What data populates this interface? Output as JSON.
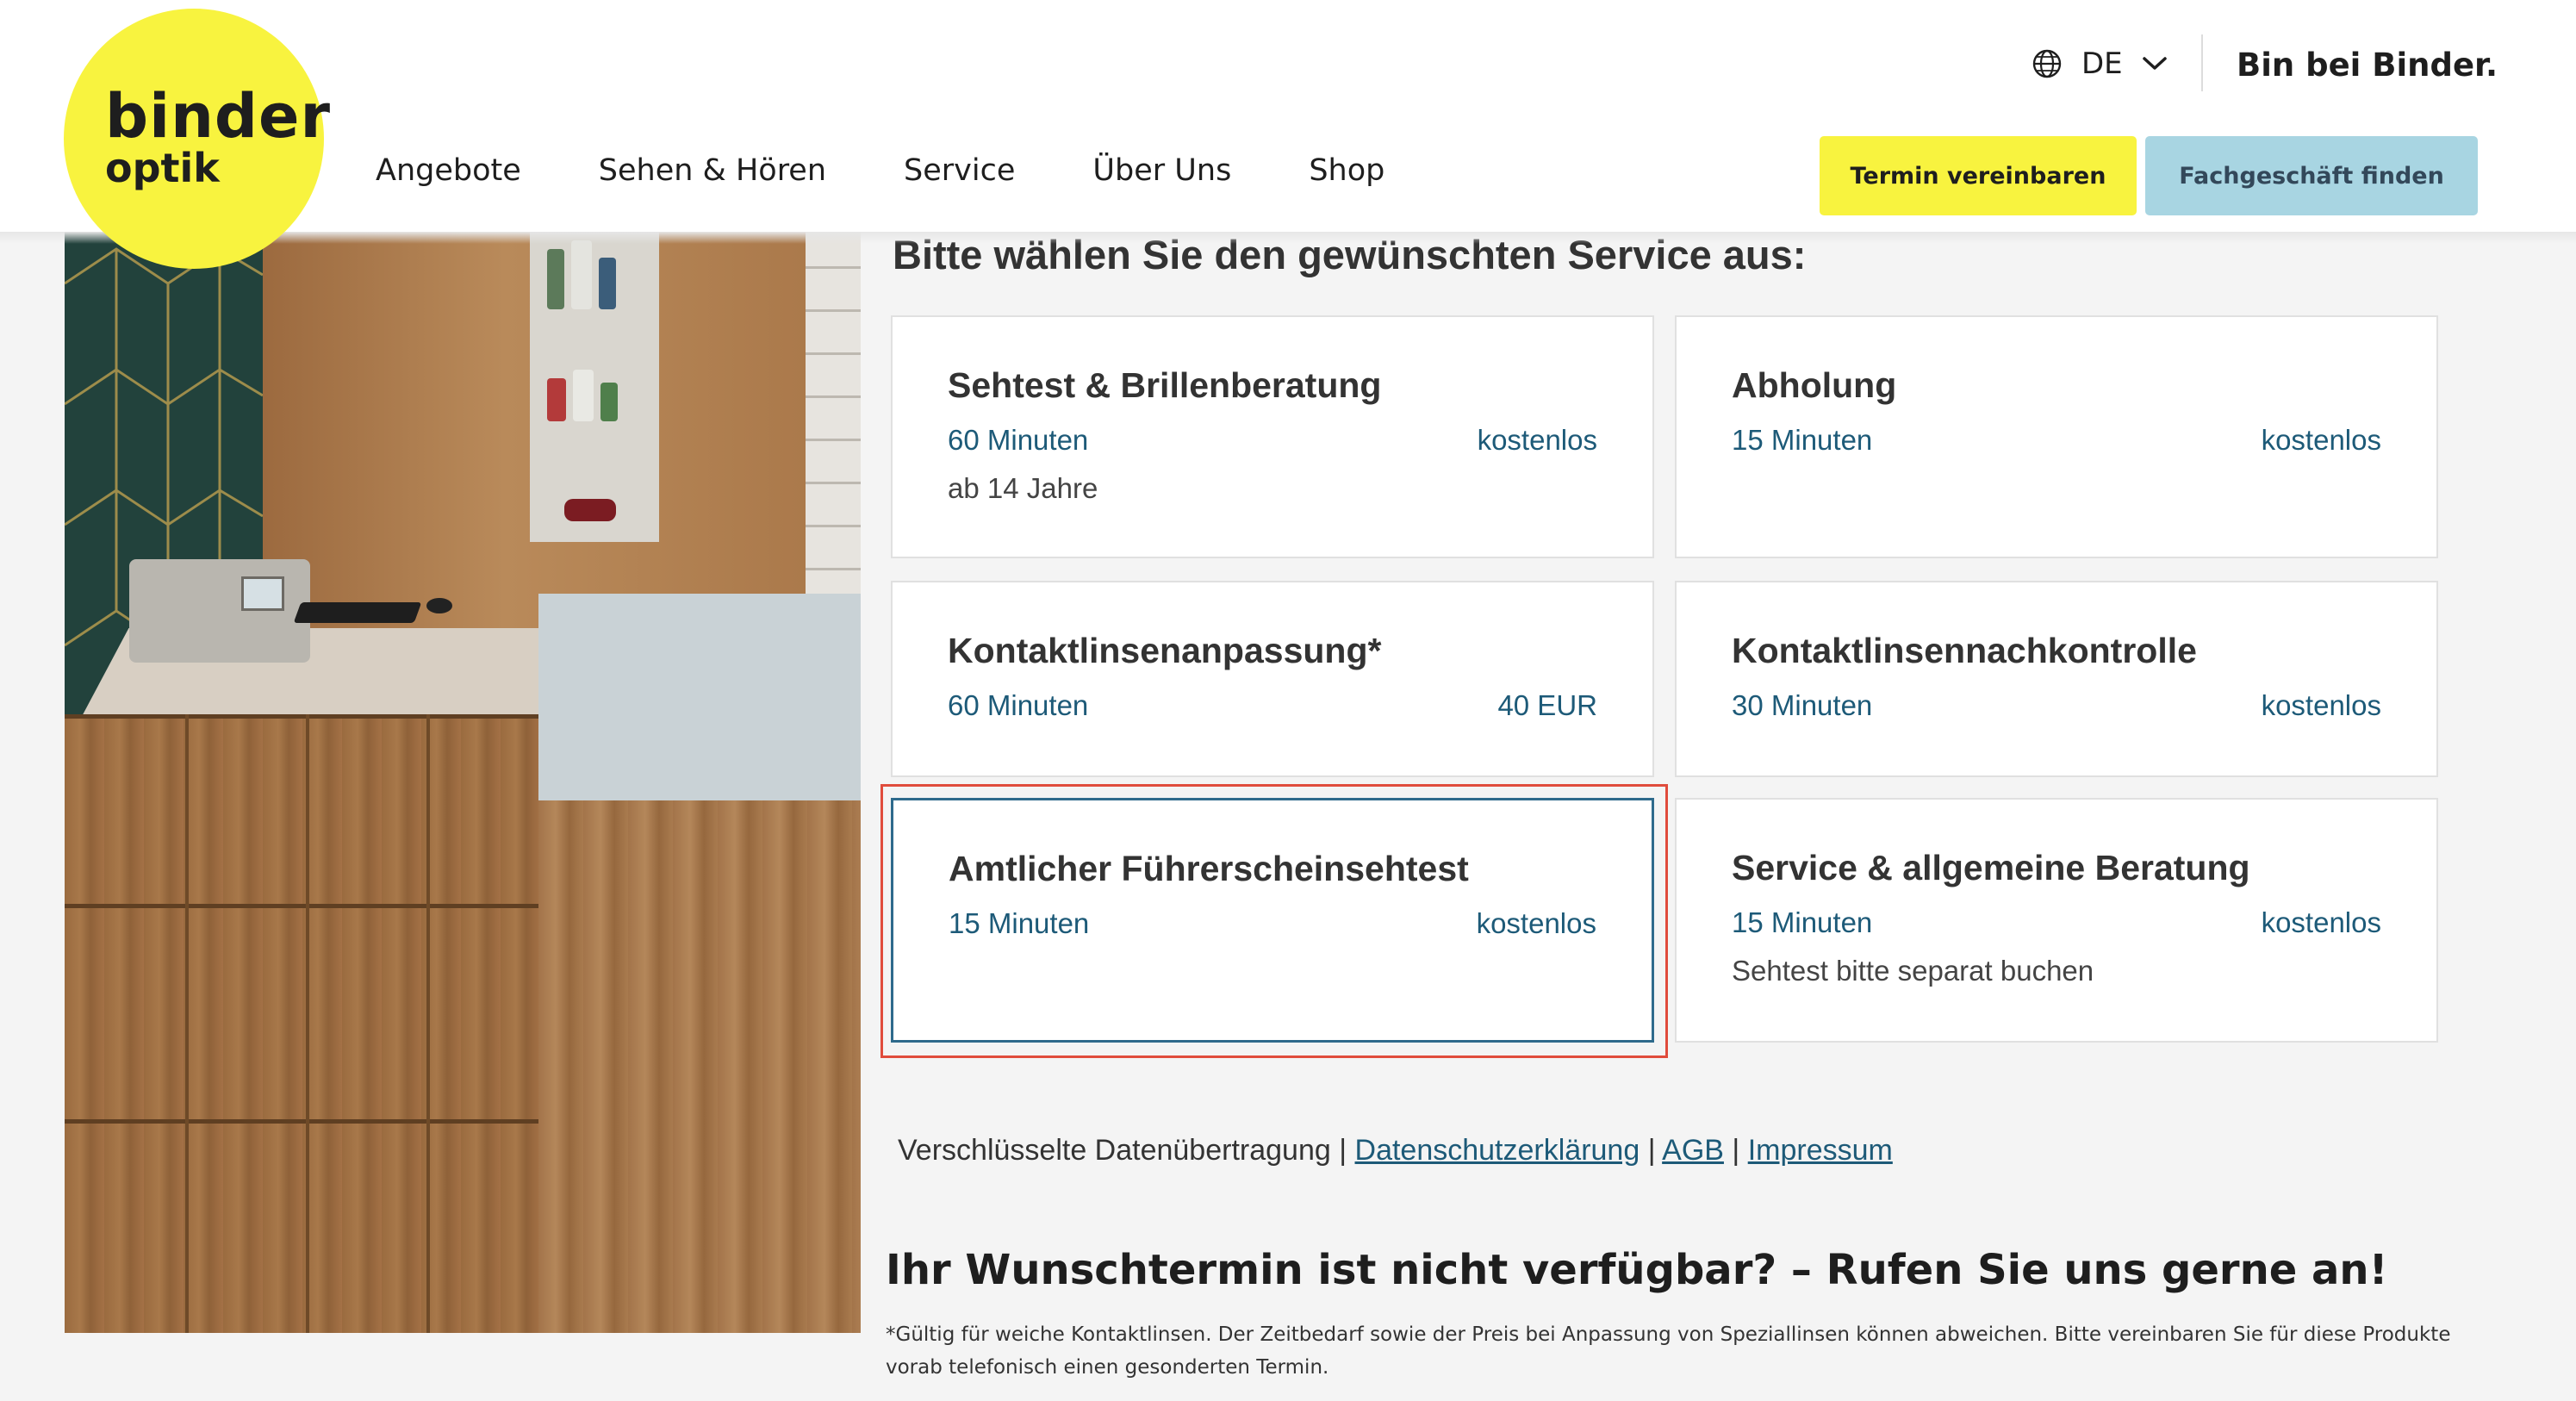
{
  "brand": {
    "logo_line_1": "binder",
    "logo_line_2": "optik",
    "yellow": "#f8f33f",
    "light_blue": "#a8d5e2",
    "link_blue": "#1d5a78"
  },
  "header": {
    "nav": [
      "Angebote",
      "Sehen & Hören",
      "Service",
      "Über Uns",
      "Shop"
    ],
    "language": {
      "icon": "globe-icon",
      "label": "DE",
      "chevron": "chevron-down-icon"
    },
    "bin_bei_binder": "Bin bei Binder.",
    "btn_termin": "Termin vereinbaren",
    "btn_fachgeschaeft": "Fachgeschäft finden"
  },
  "main": {
    "heading": "Bitte wählen Sie den gewünschten Service aus:",
    "services": [
      {
        "title": "Sehtest & Brillenberatung",
        "duration": "60 Minuten",
        "price": "kostenlos",
        "note": "ab 14 Jahre"
      },
      {
        "title": "Abholung",
        "duration": "15 Minuten",
        "price": "kostenlos",
        "note": ""
      },
      {
        "title": "Kontaktlinsenanpassung*",
        "duration": "60 Minuten",
        "price": "40 EUR",
        "note": ""
      },
      {
        "title": "Kontaktlinsennachkontrolle",
        "duration": "30 Minuten",
        "price": "kostenlos",
        "note": ""
      },
      {
        "title": "Amtlicher Führerscheinsehtest",
        "duration": "15 Minuten",
        "price": "kostenlos",
        "note": "",
        "selected": true
      },
      {
        "title": "Service & allgemeine Beratung",
        "duration": "15 Minuten",
        "price": "kostenlos",
        "note": "Sehtest bitte separat buchen"
      }
    ],
    "footer_text": "Verschlüsselte Datenübertragung",
    "sep": "|",
    "link_datenschutz": "Datenschutzerklärung",
    "link_agb": "AGB",
    "link_impressum": "Impressum",
    "cta": "Ihr Wunschtermin ist nicht verfügbar? – Rufen Sie uns gerne an!",
    "footnote": "*Gültig für weiche Kontaktlinsen. Der Zeitbedarf sowie der Preis bei Anpassung von Speziallinsen können abweichen. Bitte vereinbaren Sie für diese Produkte vorab telefonisch einen gesonderten Termin."
  }
}
